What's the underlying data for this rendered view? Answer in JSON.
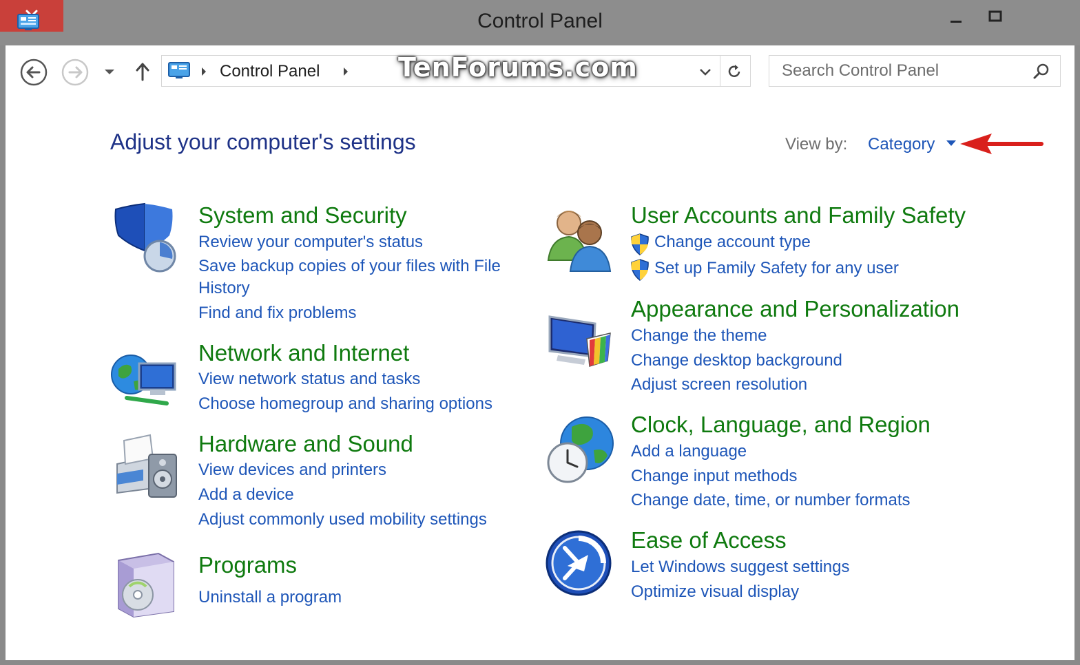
{
  "window": {
    "title": "Control Panel"
  },
  "nav": {
    "breadcrumb": [
      "Control Panel"
    ],
    "search_placeholder": "Search Control Panel",
    "watermark": "TenForums.com"
  },
  "page": {
    "heading": "Adjust your computer's settings",
    "view_by_label": "View by:",
    "view_by_value": "Category"
  },
  "categories_left": [
    {
      "title": "System and Security",
      "icon": "shield-icon",
      "links": [
        "Review your computer's status",
        "Save backup copies of your files with File",
        "History",
        "Find and fix problems"
      ]
    },
    {
      "title": "Network and Internet",
      "icon": "network-globe-icon",
      "links": [
        "View network status and tasks",
        "Choose homegroup and sharing options"
      ]
    },
    {
      "title": "Hardware and Sound",
      "icon": "printer-speaker-icon",
      "links": [
        "View devices and printers",
        "Add a device",
        "Adjust commonly used mobility settings"
      ]
    },
    {
      "title": "Programs",
      "icon": "programs-box-icon",
      "links": [
        "Uninstall a program"
      ]
    }
  ],
  "categories_right": [
    {
      "title": "User Accounts and Family Safety",
      "icon": "users-icon",
      "links": [
        "Change account type",
        "Set up Family Safety for any user"
      ]
    },
    {
      "title": "Appearance and Personalization",
      "icon": "monitor-palette-icon",
      "links": [
        "Change the theme",
        "Change desktop background",
        "Adjust screen resolution"
      ]
    },
    {
      "title": "Clock, Language, and Region",
      "icon": "clock-globe-icon",
      "links": [
        "Add a language",
        "Change input methods",
        "Change date, time, or number formats"
      ]
    },
    {
      "title": "Ease of Access",
      "icon": "ease-of-access-icon",
      "links": [
        "Let Windows suggest settings",
        "Optimize visual display"
      ]
    }
  ],
  "colors": {
    "title_bar": "#8d8d8d",
    "close_button": "#c9403a",
    "category_title": "#0f7a0f",
    "link": "#1e56b8",
    "heading": "#1e3287",
    "annotation_arrow": "#d9201c"
  }
}
